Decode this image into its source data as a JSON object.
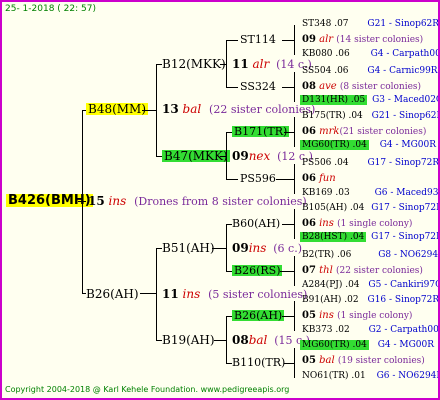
{
  "header": {
    "date": "25- 1-2018 ( 22: 57)"
  },
  "footer": {
    "text": "Copyright 2004-2018 @ Karl Kehele Foundation.   www.pedigreeapis.org"
  },
  "root": {
    "name": "B426(BMH)",
    "year": "15",
    "type": "ins",
    "note": "(Drones from 8 sister colonies)"
  },
  "sire": {
    "name": "B48(MM)",
    "year": "13",
    "type": "bal",
    "note": "(22 sister colonies)",
    "sire": {
      "name": "B12(MKK)",
      "year": "11",
      "type": "alr",
      "note": "(14 c.)",
      "sire": {
        "name": "ST114",
        "year": "09",
        "type": "alr",
        "note": "(14 sister colonies)",
        "sire_line": {
          "name": "ST348 .07",
          "tag": "G21 - Sinop62R"
        },
        "dam_line": {
          "name": "KB080 .06",
          "tag": "G4 - Carpath00R"
        }
      },
      "dam": {
        "name": "SS324",
        "year": "08",
        "type": "ave",
        "note": "(8 sister colonies)",
        "sire_line": {
          "name": "SS504 .06",
          "tag": "G4 - Carnic99R"
        },
        "dam_line": {
          "name": "D131(HR) .05",
          "tag": "G3 - Maced02Q"
        }
      }
    },
    "dam": {
      "name": "B47(MKK)",
      "year": "09",
      "type": "nex",
      "note": "(12 c.)",
      "sire": {
        "name": "B171(TR)",
        "year": "06",
        "type": "mrk",
        "note": "(21 sister colonies)",
        "sire_line": {
          "name": "B175(TR) .04",
          "tag": "G21 - Sinop62R"
        },
        "dam_line": {
          "name": "MG60(TR) .04",
          "tag": "G4 - MG00R"
        }
      },
      "dam": {
        "name": "PS596",
        "year": "06",
        "type": "fun",
        "note": "",
        "sire_line": {
          "name": "PS506 .04",
          "tag": "G17 - Sinop72R"
        },
        "dam_line": {
          "name": "KB169 .03",
          "tag": "G6 - Maced93R"
        }
      }
    }
  },
  "dam": {
    "name": "B26(AH)",
    "year": "11",
    "type": "ins",
    "note": "(5 sister colonies)",
    "sire": {
      "name": "B51(AH)",
      "year": "09",
      "type": "ins",
      "note": "(6 c.)",
      "sire": {
        "name": "B60(AH)",
        "year": "06",
        "type": "ins",
        "note": "(1 single colony)",
        "sire_line": {
          "name": "B105(AH) .04",
          "tag": "G17 - Sinop72R"
        },
        "dam_line": {
          "name": "B28(HST) .04",
          "tag": "G17 - Sinop72R"
        }
      },
      "dam": {
        "name": "B26(RS)",
        "year": "07",
        "type": "thl",
        "note": "(22 sister colonies)",
        "sire_line": {
          "name": "B2(TR) .06",
          "tag": "G8 - NO6294R"
        },
        "dam_line": {
          "name": "A284(PJ) .04",
          "tag": "G5 - Cankiri97Q"
        }
      }
    },
    "dam": {
      "name": "B19(AH)",
      "year": "08",
      "type": "bal",
      "note": "(15 c.)",
      "sire": {
        "name": "B26(AH)",
        "year": "05",
        "type": "ins",
        "note": "(1 single colony)",
        "sire_line": {
          "name": "B91(AH) .02",
          "tag": "G16 - Sinop72R"
        },
        "dam_line": {
          "name": "KB373 .02",
          "tag": "G2 - Carpath00R"
        }
      },
      "dam": {
        "name": "B110(TR)",
        "year": "05",
        "type": "bal",
        "note": "(19 sister colonies)",
        "sire_line": {
          "name": "MG60(TR) .04",
          "tag": "G4 - MG00R"
        },
        "dam_line": {
          "name": "NO61(TR) .01",
          "tag": "G6 - NO6294R"
        }
      }
    }
  }
}
